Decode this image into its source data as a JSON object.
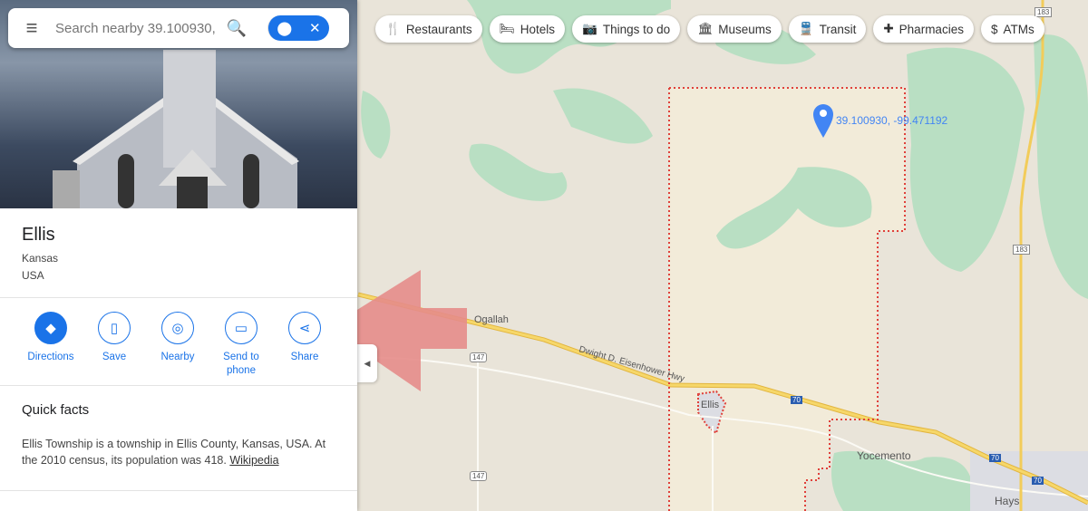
{
  "search": {
    "placeholder": "Search nearby 39.100930, -"
  },
  "place": {
    "name": "Ellis",
    "region": "Kansas",
    "country": "USA"
  },
  "actions": [
    {
      "label": "Directions",
      "icon": "directions-icon"
    },
    {
      "label": "Save",
      "icon": "bookmark-icon"
    },
    {
      "label": "Nearby",
      "icon": "nearby-icon"
    },
    {
      "label": "Send to phone",
      "icon": "send-to-phone-icon"
    },
    {
      "label": "Share",
      "icon": "share-icon"
    }
  ],
  "quick_facts": {
    "heading": "Quick facts",
    "text": "Ellis Township is a township in Ellis County, Kansas, USA. At the 2010 census, its population was 418.",
    "link": "Wikipedia"
  },
  "chips": [
    {
      "label": "Restaurants",
      "icon": "🍴"
    },
    {
      "label": "Hotels",
      "icon": "🛏"
    },
    {
      "label": "Things to do",
      "icon": "📷"
    },
    {
      "label": "Museums",
      "icon": "🏛"
    },
    {
      "label": "Transit",
      "icon": "🚆"
    },
    {
      "label": "Pharmacies",
      "icon": "✚"
    },
    {
      "label": "ATMs",
      "icon": "$"
    }
  ],
  "map": {
    "pin_label": "39.100930, -99.471192",
    "towns": [
      "Ogallah",
      "Ellis",
      "Yocemento",
      "Hays"
    ],
    "highway_name": "Dwight D. Eisenhower Hwy",
    "route_shields": [
      "147",
      "147",
      "70",
      "70",
      "70",
      "183",
      "183"
    ]
  },
  "colors": {
    "accent": "#1a73e8",
    "boundary": "#e0403a",
    "road": "#f2cc5a",
    "park": "#b9dfc3",
    "arrow": "#e58c8a"
  }
}
